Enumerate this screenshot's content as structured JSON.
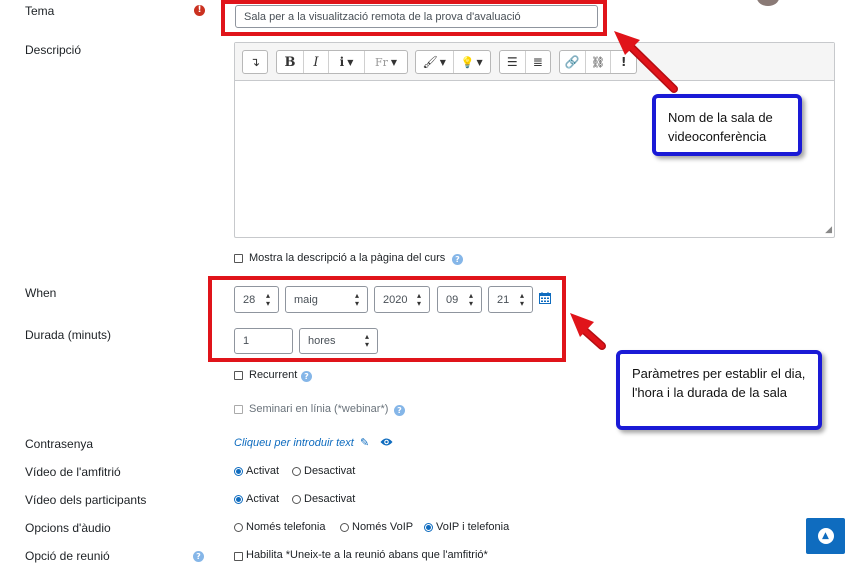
{
  "form": {
    "tema": {
      "label": "Tema",
      "value": "Sala per a la visualització remota de la prova d'avaluació"
    },
    "descripcio": {
      "label": "Descripció"
    },
    "mostra_descripcio": {
      "label": "Mostra la descripció a la pàgina del curs",
      "checked": false
    },
    "when": {
      "label": "When",
      "day": "28",
      "month": "maig",
      "year": "2020",
      "hour": "09",
      "minute": "21"
    },
    "durada": {
      "label": "Durada (minuts)",
      "value": "1",
      "unit": "hores"
    },
    "recurrent": {
      "label": "Recurrent",
      "checked": false
    },
    "seminari": {
      "label": "Seminari en línia (*webinar*)",
      "checked": false,
      "disabled": true
    },
    "contrasenya": {
      "label": "Contrasenya",
      "link": "Cliqueu per introduir text"
    },
    "video_amfitrio": {
      "label": "Vídeo de l'amfitrió",
      "options": [
        "Activat",
        "Desactivat"
      ],
      "selected": "Activat"
    },
    "video_participants": {
      "label": "Vídeo dels participants",
      "options": [
        "Activat",
        "Desactivat"
      ],
      "selected": "Activat"
    },
    "opcions_audio": {
      "label": "Opcions d'àudio",
      "options": [
        "Només telefonia",
        "Només VoIP",
        "VoIP i telefonia"
      ],
      "selected": "VoIP i telefonia"
    },
    "opcio_reunio": {
      "label": "Opció de reunió",
      "checkbox_label": "Habilita *Uneix-te a la reunió abans que l'amfitrió*"
    }
  },
  "editor_toolbar": {
    "icons": [
      "collapse-icon",
      "bold-icon",
      "italic-icon",
      "info-icon",
      "font-icon",
      "brush-icon",
      "lightbulb-icon",
      "bullet-list-icon",
      "numbered-list-icon",
      "link-icon",
      "unlink-icon",
      "exclamation-icon"
    ],
    "bold": "B",
    "italic": "I"
  },
  "callouts": {
    "tema": "Nom de la sala de videoconferència",
    "when": "Paràmetres per establir el dia, l'hora i la durada de la sala"
  },
  "colors": {
    "highlight_box": "#e0141a",
    "callout_border": "#1a1ad6",
    "accent": "#0f6cbf",
    "required": "#ca3120"
  }
}
